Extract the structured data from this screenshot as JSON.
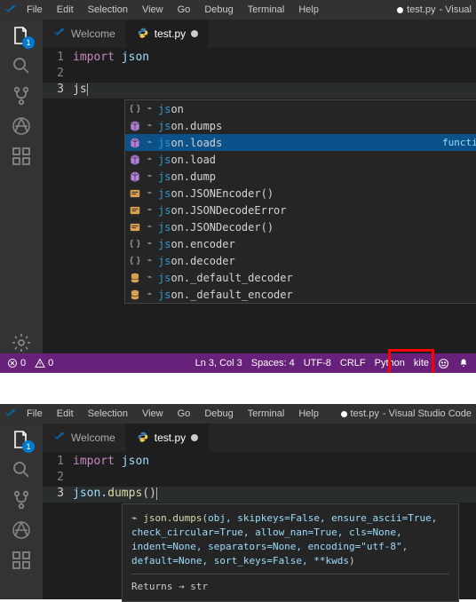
{
  "window1": {
    "menu": [
      "File",
      "Edit",
      "Selection",
      "View",
      "Go",
      "Debug",
      "Terminal",
      "Help"
    ],
    "title_file": "test.py",
    "title_suffix": " - Visual",
    "tabs": [
      {
        "label": "Welcome"
      },
      {
        "label": "test.py"
      }
    ],
    "file_badge": "1",
    "lines": {
      "l1": "1",
      "l2": "2",
      "l3": "3",
      "code1_kw": "import",
      "code1_id": " json",
      "code3": "js"
    },
    "suggest": [
      {
        "kind": "braces",
        "kite": "⌁",
        "match": "js",
        "rest": "on"
      },
      {
        "kind": "cube",
        "kite": "⌁",
        "match": "js",
        "rest": "on.dumps"
      },
      {
        "kind": "cube",
        "kite": "⌁",
        "match": "js",
        "rest": "on.loads",
        "selected": true,
        "hint": "function"
      },
      {
        "kind": "cube",
        "kite": "⌁",
        "match": "js",
        "rest": "on.load"
      },
      {
        "kind": "cube",
        "kite": "⌁",
        "match": "js",
        "rest": "on.dump"
      },
      {
        "kind": "snip",
        "kite": "⌁",
        "match": "js",
        "rest": "on.JSONEncoder()"
      },
      {
        "kind": "snip",
        "kite": "⌁",
        "match": "js",
        "rest": "on.JSONDecodeError"
      },
      {
        "kind": "snip",
        "kite": "⌁",
        "match": "js",
        "rest": "on.JSONDecoder()"
      },
      {
        "kind": "braces",
        "kite": "⌁",
        "match": "js",
        "rest": "on.encoder"
      },
      {
        "kind": "braces",
        "kite": "⌁",
        "match": "js",
        "rest": "on.decoder"
      },
      {
        "kind": "db",
        "kite": "⌁",
        "match": "js",
        "rest": "on._default_decoder"
      },
      {
        "kind": "db",
        "kite": "⌁",
        "match": "js",
        "rest": "on._default_encoder"
      }
    ],
    "status": {
      "errors": "0",
      "warnings": "0",
      "pos": "Ln 3, Col 3",
      "spaces": "Spaces: 4",
      "encoding": "UTF-8",
      "eol": "CRLF",
      "lang": "Python",
      "kite": "kite"
    }
  },
  "window2": {
    "menu": [
      "File",
      "Edit",
      "Selection",
      "View",
      "Go",
      "Debug",
      "Terminal",
      "Help"
    ],
    "title_file": "test.py",
    "title_suffix": " - Visual Studio Code",
    "tabs": [
      {
        "label": "Welcome"
      },
      {
        "label": "test.py"
      }
    ],
    "file_badge": "1",
    "lines": {
      "l1": "1",
      "l2": "2",
      "l3": "3",
      "code1_kw": "import",
      "code1_id": " json",
      "code3_pre": "json.",
      "code3_fn": "dumps",
      "code3_post": "()"
    },
    "hover": {
      "kite": "⌁ ",
      "sig_fn": "json.dumps",
      "sig_open": "(",
      "sig_params": "obj, skipkeys=False, ensure_ascii=True, check_circular=True, allow_nan=True, cls=None, indent=None, separators=None, encoding=\"utf-8\", default=None, sort_keys=False, **kwds",
      "sig_close": ")",
      "returns": "Returns → str"
    }
  }
}
